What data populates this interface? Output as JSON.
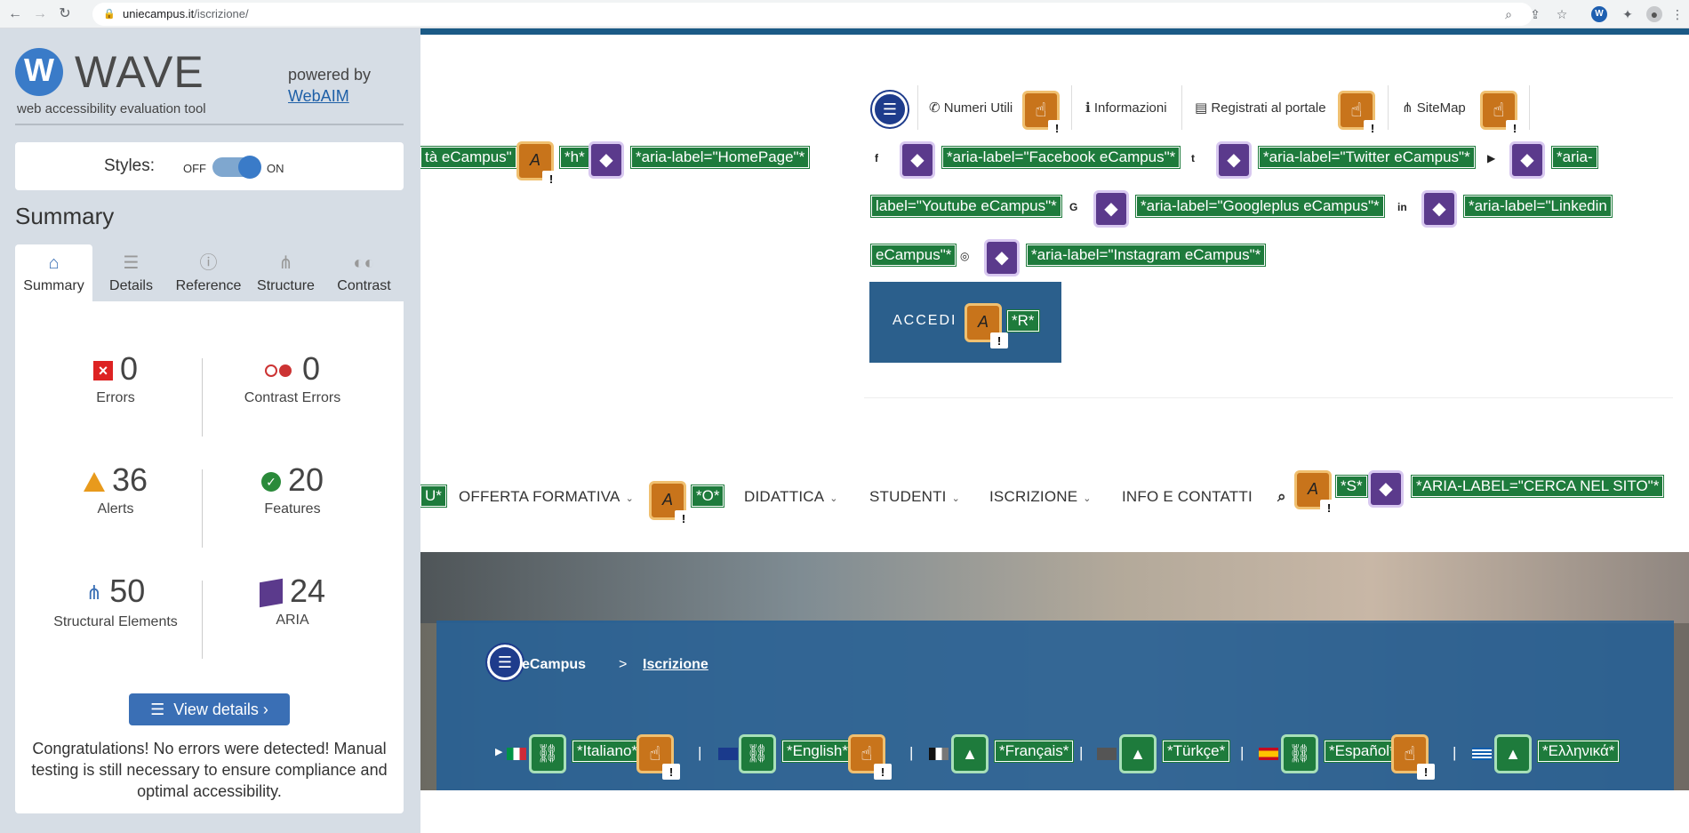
{
  "browser": {
    "url_domain": "uniecampus.it",
    "url_path": "/iscrizione/"
  },
  "wave": {
    "logo_text": "WAVE",
    "tagline": "web accessibility evaluation tool",
    "powered_by": "powered by",
    "webaim_link": "WebAIM",
    "styles_label": "Styles:",
    "styles_off": "OFF",
    "styles_on": "ON",
    "summary_title": "Summary",
    "tabs": [
      {
        "label": "Summary",
        "icon": "home-icon"
      },
      {
        "label": "Details",
        "icon": "list-icon"
      },
      {
        "label": "Reference",
        "icon": "info-icon"
      },
      {
        "label": "Structure",
        "icon": "sitemap-icon"
      },
      {
        "label": "Contrast",
        "icon": "contrast-icon"
      }
    ],
    "stats": {
      "errors": {
        "count": "0",
        "label": "Errors"
      },
      "contrast_errors": {
        "count": "0",
        "label": "Contrast Errors"
      },
      "alerts": {
        "count": "36",
        "label": "Alerts"
      },
      "features": {
        "count": "20",
        "label": "Features"
      },
      "structural": {
        "count": "50",
        "label": "Structural Elements"
      },
      "aria": {
        "count": "24",
        "label": "ARIA"
      }
    },
    "view_details": "View details ›",
    "congrats": "Congratulations! No errors were detected! Manual testing is still necessary to ensure compliance and optimal accessibility."
  },
  "page": {
    "homepage_fragment": "tà eCampus\"",
    "homepage_h": "*h*",
    "homepage_aria": "*aria-label=\"HomePage\"*",
    "util_links": [
      "Numeri Utili",
      "Informazioni",
      "Registrati al portale",
      "SiteMap"
    ],
    "social_aria": {
      "facebook": "*aria-label=\"Facebook eCampus\"*",
      "twitter": "*aria-label=\"Twitter eCampus\"*",
      "youtube_1": "*aria-",
      "youtube_2": "label=\"Youtube eCampus\"*",
      "googleplus": "*aria-label=\"Googleplus eCampus\"*",
      "linkedin_1": "*aria-label=\"Linkedin",
      "linkedin_2": "eCampus\"*",
      "instagram": "*aria-label=\"Instagram eCampus\"*"
    },
    "accedi_label": "ACCEDI",
    "accedi_key": "*R*",
    "menu_fragment": "U*",
    "menu": [
      "OFFERTA FORMATIVA",
      "DIDATTICA",
      "STUDENTI",
      "ISCRIZIONE",
      "INFO E CONTATTI"
    ],
    "offerta_key": "*O*",
    "search_key": "*S*",
    "search_aria": "*ARIA-LABEL=\"CERCA NEL SITO\"*",
    "breadcrumb_home": "eCampus",
    "breadcrumb_sep": ">",
    "breadcrumb_current": "Iscrizione",
    "languages": [
      "*Italiano*",
      "*English*",
      "*Français*",
      "*Türkçe*",
      "*Español*",
      "*Ελληνικά*"
    ],
    "lang_sep": "|"
  }
}
